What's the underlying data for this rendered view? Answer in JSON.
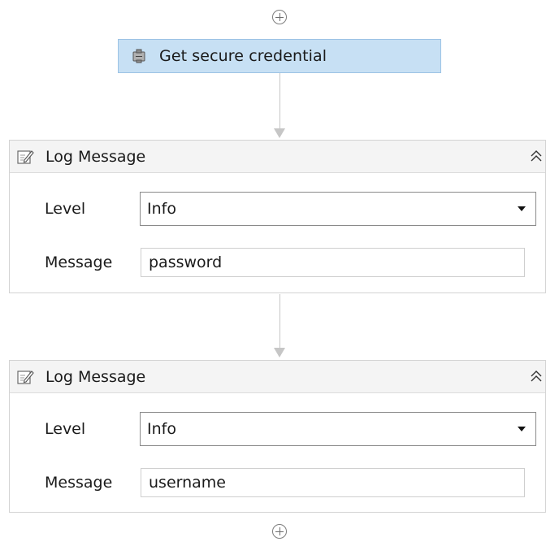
{
  "workflow": {
    "get_credential": {
      "label": "Get secure credential"
    },
    "log_message_1": {
      "title": "Log Message",
      "level_label": "Level",
      "level_value": "Info",
      "message_label": "Message",
      "message_value": "password"
    },
    "log_message_2": {
      "title": "Log Message",
      "level_label": "Level",
      "level_value": "Info",
      "message_label": "Message",
      "message_value": "username"
    }
  },
  "icons": {
    "add": "plus-circle-icon",
    "get_credential": "secure-credential-icon",
    "log": "log-message-icon",
    "collapse": "double-chevron-up-icon",
    "dropdown": "dropdown-arrow-icon"
  },
  "colors": {
    "selected_activity_bg": "#c7e0f4",
    "selected_activity_border": "#9cc3e5",
    "connector": "#c6c6c6",
    "card_header_bg": "#f4f4f4"
  }
}
